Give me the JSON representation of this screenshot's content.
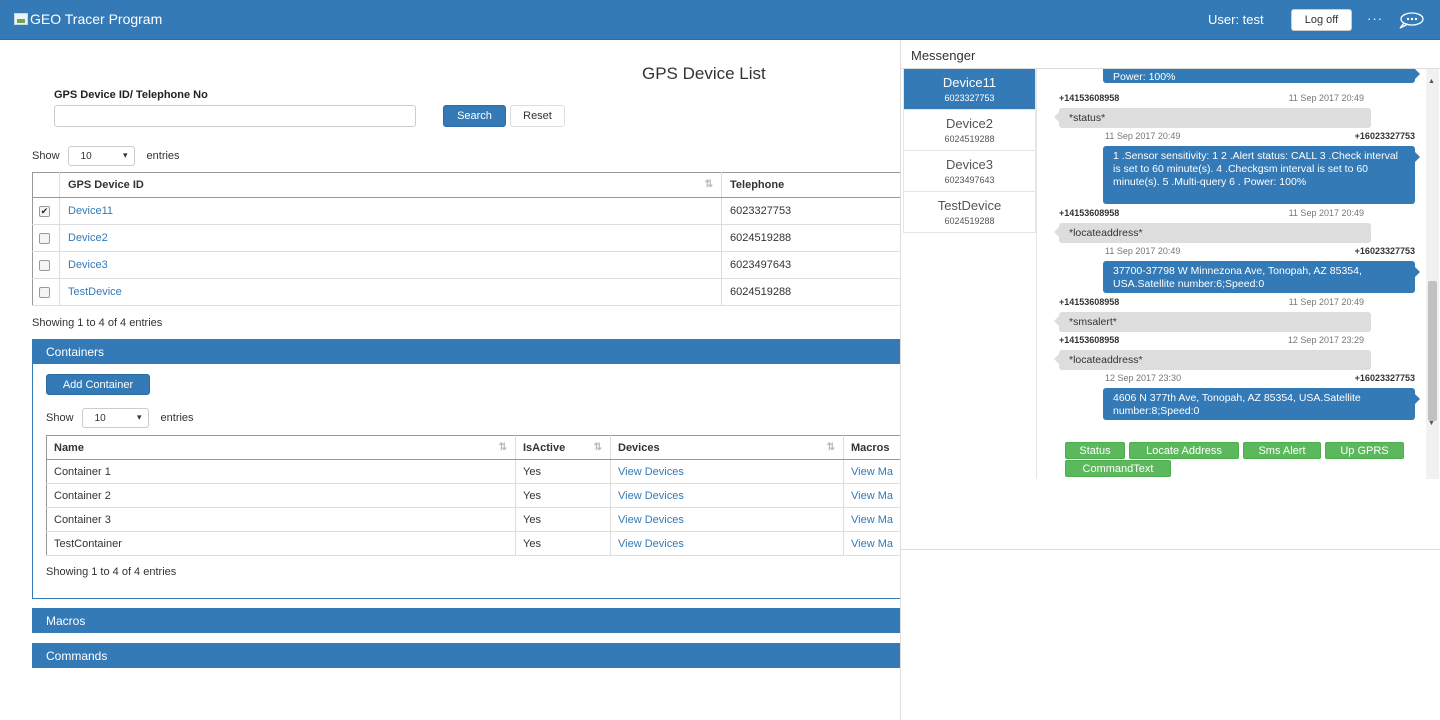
{
  "navbar": {
    "brand": "GEO Tracer Program",
    "user_label": "User: test",
    "logoff_label": "Log off",
    "more_label": "···"
  },
  "devices_section": {
    "title": "GPS Device List",
    "search_label": "GPS Device ID/ Telephone No",
    "search_value": "",
    "search_button": "Search",
    "reset_button": "Reset",
    "show_label": "Show",
    "entries_label": "entries",
    "page_size": "10",
    "columns": [
      "GPS Device ID",
      "Telephone"
    ],
    "rows": [
      {
        "checked": true,
        "id": "Device11",
        "telephone": "6023327753"
      },
      {
        "checked": false,
        "id": "Device2",
        "telephone": "6024519288"
      },
      {
        "checked": false,
        "id": "Device3",
        "telephone": "6023497643"
      },
      {
        "checked": false,
        "id": "TestDevice",
        "telephone": "6024519288"
      }
    ],
    "info": "Showing 1 to 4 of 4 entries"
  },
  "containers_panel": {
    "title": "Containers",
    "add_button": "Add Container",
    "show_label": "Show",
    "entries_label": "entries",
    "page_size": "10",
    "columns": [
      "Name",
      "IsActive",
      "Devices",
      "Macros"
    ],
    "rows": [
      {
        "name": "Container 1",
        "active": "Yes",
        "devices": "View Devices",
        "macros": "View Ma"
      },
      {
        "name": "Container 2",
        "active": "Yes",
        "devices": "View Devices",
        "macros": "View Ma"
      },
      {
        "name": "Container 3",
        "active": "Yes",
        "devices": "View Devices",
        "macros": "View Ma"
      },
      {
        "name": "TestContainer",
        "active": "Yes",
        "devices": "View Devices",
        "macros": "View Ma"
      }
    ],
    "info": "Showing 1 to 4 of 4 entries"
  },
  "macros_panel": {
    "title": "Macros"
  },
  "commands_panel": {
    "title": "Commands"
  },
  "messenger": {
    "title": "Messenger",
    "devices": [
      {
        "name": "Device11",
        "phone": "6023327753",
        "active": true
      },
      {
        "name": "Device2",
        "phone": "6024519288",
        "active": false
      },
      {
        "name": "Device3",
        "phone": "6023497643",
        "active": false
      },
      {
        "name": "TestDevice",
        "phone": "6024519288",
        "active": false
      }
    ],
    "messages": [
      {
        "dir": "out",
        "text": "Power: 100%"
      },
      {
        "dir": "in",
        "from": "+14153608958",
        "time": "11 Sep 2017 20:49",
        "text": "*status*"
      },
      {
        "dir": "out",
        "from": "+16023327753",
        "time": "11 Sep 2017 20:49",
        "text": "1 .Sensor sensitivity: 1 2 .Alert status: CALL 3 .Check interval is set to 60 minute(s). 4 .Checkgsm interval is set to 60 minute(s). 5 .Multi-query 6 . Power: 100%"
      },
      {
        "dir": "in",
        "from": "+14153608958",
        "time": "11 Sep 2017 20:49",
        "text": "*locateaddress*"
      },
      {
        "dir": "out",
        "from": "+16023327753",
        "time": "11 Sep 2017 20:49",
        "text": "37700-37798 W Minnezona Ave, Tonopah, AZ 85354, USA.Satellite number:6;Speed:0"
      },
      {
        "dir": "in",
        "from": "+14153608958",
        "time": "11 Sep 2017 20:49",
        "text": "*smsalert*"
      },
      {
        "dir": "in",
        "from": "+14153608958",
        "time": "12 Sep 2017 23:29",
        "text": "*locateaddress*"
      },
      {
        "dir": "out",
        "from": "+16023327753",
        "time": "12 Sep 2017 23:30",
        "text": "4606 N 377th Ave, Tonopah, AZ 85354, USA.Satellite number:8;Speed:0"
      }
    ],
    "commands": [
      "Status",
      "Locate Address",
      "Sms Alert",
      "Up GPRS",
      "CommandText"
    ]
  },
  "colors": {
    "primary": "#337ab7",
    "success": "#5cb85c",
    "bubble_in": "#dddddd"
  }
}
